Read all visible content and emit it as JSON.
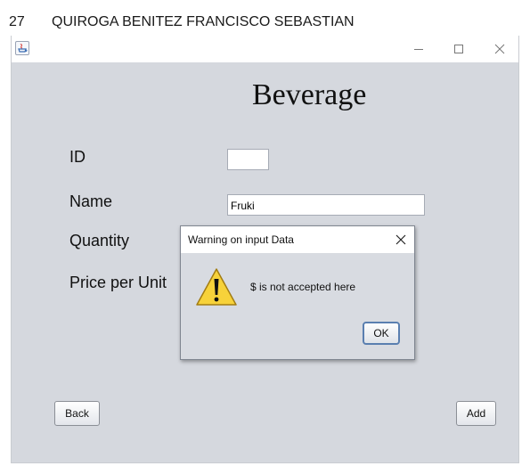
{
  "caption": {
    "number": "27",
    "name": "QUIROGA BENITEZ FRANCISCO SEBASTIAN"
  },
  "window": {
    "icon": "java-icon",
    "controls": {
      "minimize": "minimize-icon",
      "maximize": "maximize-icon",
      "close": "close-icon"
    }
  },
  "form": {
    "heading": "Beverage",
    "fields": {
      "id": {
        "label": "ID",
        "value": ""
      },
      "name": {
        "label": "Name",
        "value": "Fruki"
      },
      "quantity": {
        "label": "Quantity"
      },
      "price": {
        "label": "Price per Unit"
      }
    },
    "back_button": "Back",
    "add_button": "Add"
  },
  "dialog": {
    "title": "Warning on input Data",
    "message": "$ is not accepted here",
    "ok_button": "OK",
    "icon": "warning-icon"
  },
  "colors": {
    "panel_background": "#d5d8de",
    "warning_yellow": "#f7d23a"
  }
}
